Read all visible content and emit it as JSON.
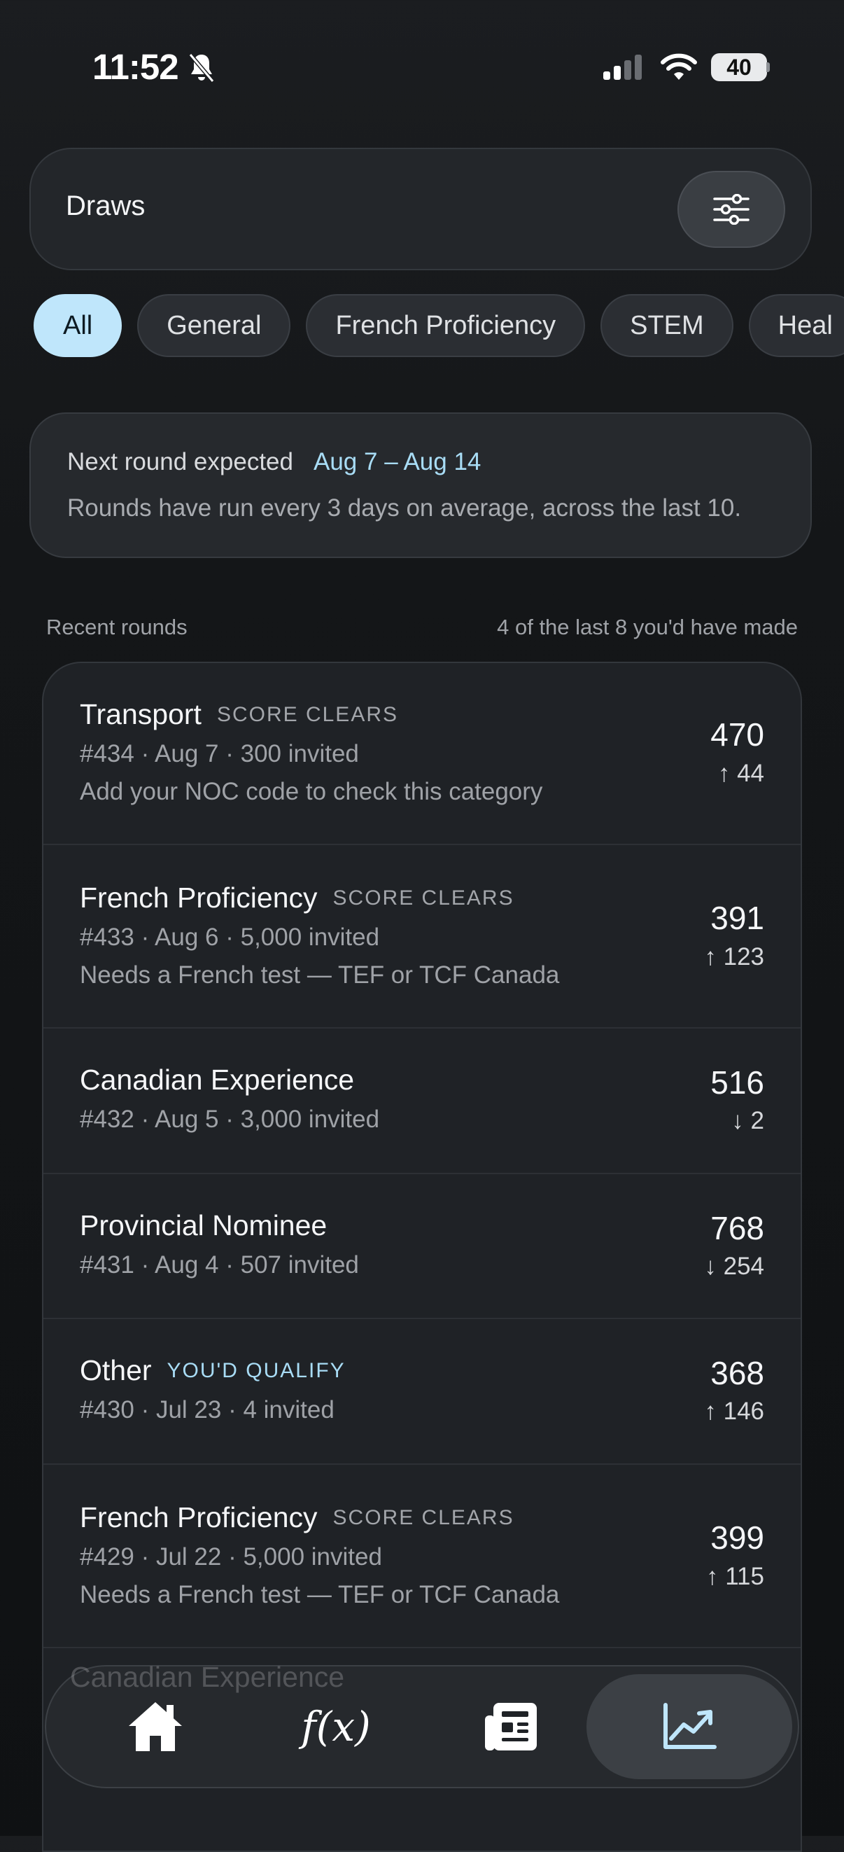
{
  "status_bar": {
    "time": "11:52",
    "battery": "40"
  },
  "header": {
    "title": "Draws"
  },
  "chips": [
    "All",
    "General",
    "French Proficiency",
    "STEM",
    "Heal"
  ],
  "next_round": {
    "label": "Next round expected",
    "dates": "Aug 7 – Aug 14",
    "description": "Rounds have run every 3 days on average, across the last 10."
  },
  "section": {
    "title": "Recent rounds",
    "summary": "4 of the last 8 you'd have made"
  },
  "rounds": [
    {
      "title": "Transport",
      "tag": "SCORE CLEARS",
      "meta": "#434 · Aug 7 · 300 invited",
      "note": "Add your NOC code to check this category",
      "score": "470",
      "delta": "↑ 44"
    },
    {
      "title": "French Proficiency",
      "tag": "SCORE CLEARS",
      "meta": "#433 · Aug 6 · 5,000 invited",
      "note": "Needs a French test — TEF or TCF Canada",
      "score": "391",
      "delta": "↑ 123"
    },
    {
      "title": "Canadian Experience",
      "tag": "",
      "meta": "#432 · Aug 5 · 3,000 invited",
      "note": "",
      "score": "516",
      "delta": "↓ 2"
    },
    {
      "title": "Provincial Nominee",
      "tag": "",
      "meta": "#431 · Aug 4 · 507 invited",
      "note": "",
      "score": "768",
      "delta": "↓ 254"
    },
    {
      "title": "Other",
      "tag": "YOU'D QUALIFY",
      "meta": "#430 · Jul 23 · 4 invited",
      "note": "",
      "score": "368",
      "delta": "↑ 146"
    },
    {
      "title": "French Proficiency",
      "tag": "SCORE CLEARS",
      "meta": "#429 · Jul 22 · 5,000 invited",
      "note": "Needs a French test — TEF or TCF Canada",
      "score": "399",
      "delta": "↑ 115"
    }
  ],
  "ghost_row": {
    "title": "Canadian Experience"
  },
  "nav": {
    "items": [
      "home-icon",
      "formula-icon",
      "news-icon",
      "chart-trend-icon"
    ],
    "fx_label": "f(x)",
    "active": "chart-trend-icon"
  },
  "colors": {
    "accent": "#a8dcf5",
    "chip_active": "#bfe6fb",
    "background": "#141618"
  }
}
